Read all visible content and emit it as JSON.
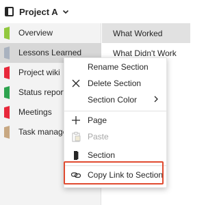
{
  "header": {
    "notebook_title": "Project A"
  },
  "sections": [
    {
      "label": "Overview",
      "color": "#92c83e",
      "selected": false
    },
    {
      "label": "Lessons Learned",
      "color": "#a9b2bf",
      "selected": true
    },
    {
      "label": "Project wiki",
      "color": "#e8283b",
      "selected": false
    },
    {
      "label": "Status reports",
      "color": "#2ea44f",
      "selected": false
    },
    {
      "label": "Meetings",
      "color": "#e8283b",
      "selected": false
    },
    {
      "label": "Task management",
      "color": "#c8a882",
      "selected": false
    }
  ],
  "pages": [
    {
      "label": "What Worked",
      "selected": true
    },
    {
      "label": "What Didn't Work",
      "selected": false
    }
  ],
  "context_menu": {
    "rename": "Rename Section",
    "delete": "Delete Section",
    "color": "Section Color",
    "page": "Page",
    "paste": "Paste",
    "section": "Section",
    "copy_link": "Copy Link to Section"
  },
  "colors": {
    "highlight": "#e04a2f"
  }
}
